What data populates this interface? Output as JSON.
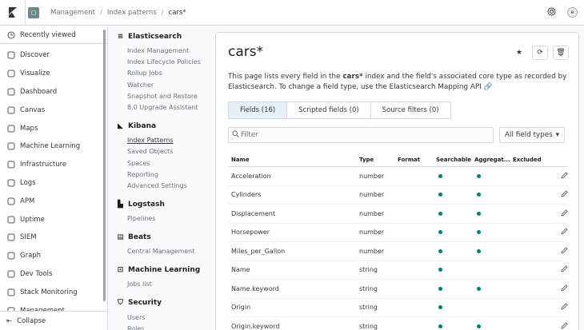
{
  "breadcrumbs": [
    "Management",
    "Index patterns",
    "cars*"
  ],
  "user_initial": "e",
  "nav": {
    "recently_viewed": "Recently viewed",
    "items": [
      {
        "label": "Discover",
        "icon": "compass-icon"
      },
      {
        "label": "Visualize",
        "icon": "visualize-icon"
      },
      {
        "label": "Dashboard",
        "icon": "dashboard-icon"
      },
      {
        "label": "Canvas",
        "icon": "canvas-icon"
      },
      {
        "label": "Maps",
        "icon": "maps-icon"
      },
      {
        "label": "Machine Learning",
        "icon": "ml-icon"
      },
      {
        "label": "Infrastructure",
        "icon": "infrastructure-icon"
      },
      {
        "label": "Logs",
        "icon": "logs-icon"
      },
      {
        "label": "APM",
        "icon": "apm-icon"
      },
      {
        "label": "Uptime",
        "icon": "uptime-icon"
      },
      {
        "label": "SIEM",
        "icon": "siem-icon"
      },
      {
        "label": "Graph",
        "icon": "graph-icon"
      },
      {
        "label": "Dev Tools",
        "icon": "devtools-icon"
      },
      {
        "label": "Stack Monitoring",
        "icon": "monitoring-icon"
      },
      {
        "label": "Management",
        "icon": "gear-icon"
      }
    ],
    "collapse": "Collapse"
  },
  "mgmt": {
    "elasticsearch": {
      "title": "Elasticsearch",
      "links": [
        "Index Management",
        "Index Lifecycle Policies",
        "Rollup Jobs",
        "Watcher",
        "Snapshot and Restore",
        "8.0 Upgrade Assistant"
      ]
    },
    "kibana": {
      "title": "Kibana",
      "links": [
        "Index Patterns",
        "Saved Objects",
        "Spaces",
        "Reporting",
        "Advanced Settings"
      ]
    },
    "logstash": {
      "title": "Logstash",
      "links": [
        "Pipelines"
      ]
    },
    "beats": {
      "title": "Beats",
      "links": [
        "Central Management"
      ]
    },
    "ml": {
      "title": "Machine Learning",
      "links": [
        "Jobs list"
      ]
    },
    "security": {
      "title": "Security",
      "links": [
        "Users",
        "Roles"
      ]
    }
  },
  "page": {
    "title": "cars*",
    "desc_1": "This page lists every field in the ",
    "desc_bold": "cars*",
    "desc_2": " index and the field's associated core type as recorded by Elasticsearch. To change a field type, use the Elasticsearch ",
    "desc_api": "Mapping API",
    "tabs": [
      "Fields (16)",
      "Scripted fields (0)",
      "Source filters (0)"
    ],
    "filter_placeholder": "Filter",
    "field_types": "All field types"
  },
  "table": {
    "headers": [
      "Name",
      "Type",
      "Format",
      "Searchable",
      "Aggregat...",
      "Excluded"
    ],
    "rows": [
      {
        "name": "Acceleration",
        "type": "number",
        "searchable": true,
        "aggregatable": true
      },
      {
        "name": "Cylinders",
        "type": "number",
        "searchable": true,
        "aggregatable": true
      },
      {
        "name": "Displacement",
        "type": "number",
        "searchable": true,
        "aggregatable": true
      },
      {
        "name": "Horsepower",
        "type": "number",
        "searchable": true,
        "aggregatable": true
      },
      {
        "name": "Miles_per_Gallon",
        "type": "number",
        "searchable": true,
        "aggregatable": true
      },
      {
        "name": "Name",
        "type": "string",
        "searchable": true,
        "aggregatable": false
      },
      {
        "name": "Name.keyword",
        "type": "string",
        "searchable": true,
        "aggregatable": true
      },
      {
        "name": "Origin",
        "type": "string",
        "searchable": true,
        "aggregatable": false
      },
      {
        "name": "Origin.keyword",
        "type": "string",
        "searchable": true,
        "aggregatable": true
      }
    ]
  }
}
